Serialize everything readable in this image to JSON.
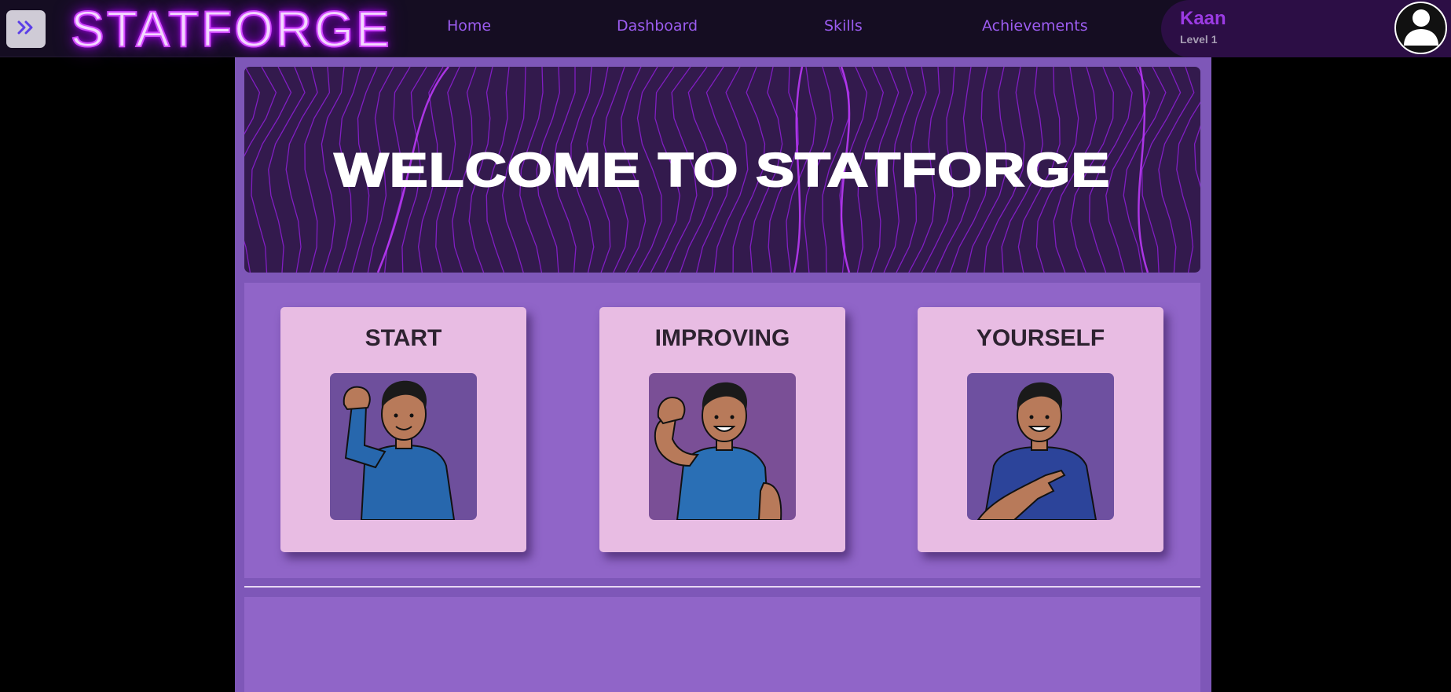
{
  "header": {
    "logo_text": "STATFORGE",
    "nav": {
      "home": "Home",
      "dashboard": "Dashboard",
      "skills": "Skills",
      "achievements": "Achievements"
    },
    "user": {
      "name": "Kaan",
      "level": "Level 1"
    },
    "icons": {
      "expand": "double-chevron-right-icon",
      "avatar": "user-silhouette-icon"
    }
  },
  "hero": {
    "title": "WELCOME TO STATFORGE"
  },
  "cards": [
    {
      "title": "START",
      "illustration": "man-raising-fist"
    },
    {
      "title": "IMPROVING",
      "illustration": "man-flexing-bicep"
    },
    {
      "title": "YOURSELF",
      "illustration": "man-pointing-at-self"
    }
  ],
  "colors": {
    "accent": "#9c5cf0",
    "neon_logo": "#d14bff",
    "background": "#000000",
    "topbar": "#150d22",
    "main_panel": "#7e57b8",
    "card_panel": "#9065c8",
    "card": "#e8bce3"
  }
}
